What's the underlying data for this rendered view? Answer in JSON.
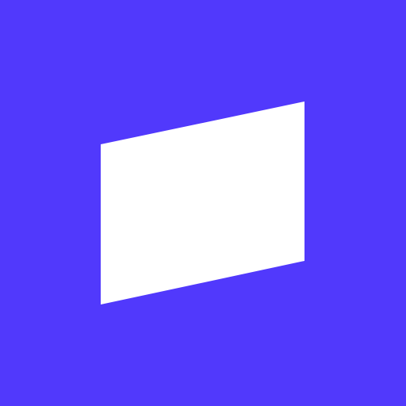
{
  "icon": {
    "name": "parallelogram-logo-icon",
    "colors": {
      "background": "#5139FC",
      "foreground": "#FFFFFF"
    }
  }
}
